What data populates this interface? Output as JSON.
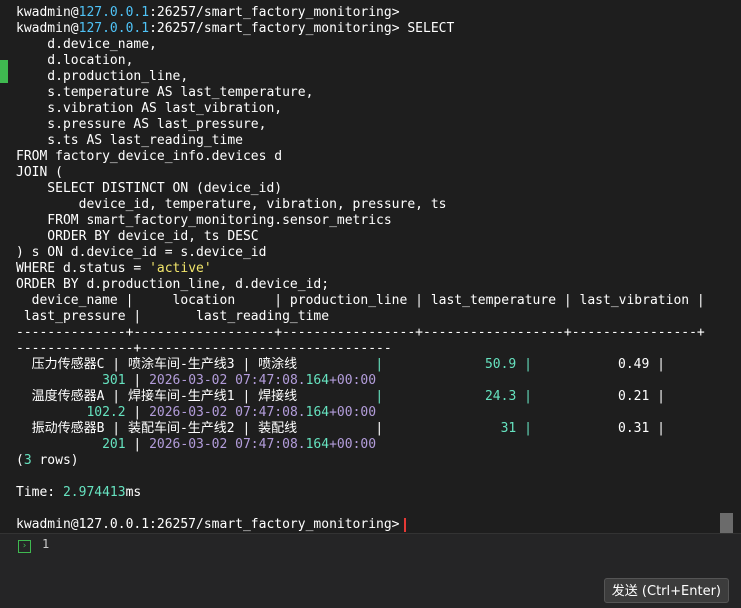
{
  "terminal": {
    "lines": [
      [
        {
          "t": "kwadmin@"
        },
        {
          "t": "127.0.0.1",
          "c": "ip"
        },
        {
          "t": ":26257/smart_factory_monitoring>"
        }
      ],
      [
        {
          "t": "kwadmin@"
        },
        {
          "t": "127.0.0.1",
          "c": "ip"
        },
        {
          "t": ":26257/smart_factory_monitoring> SELECT"
        }
      ],
      [
        {
          "t": "    d.device_name,"
        }
      ],
      [
        {
          "t": "    d.location,"
        }
      ],
      [
        {
          "t": "    d.production_line,"
        }
      ],
      [
        {
          "t": "    s.temperature AS last_temperature,"
        }
      ],
      [
        {
          "t": "    s.vibration AS last_vibration,"
        }
      ],
      [
        {
          "t": "    s.pressure AS last_pressure,"
        }
      ],
      [
        {
          "t": "    s.ts AS last_reading_time"
        }
      ],
      [
        {
          "t": "FROM factory_device_info.devices d"
        }
      ],
      [
        {
          "t": "JOIN ("
        }
      ],
      [
        {
          "t": "    SELECT DISTINCT ON (device_id)"
        }
      ],
      [
        {
          "t": "        device_id, temperature, vibration, pressure, ts"
        }
      ],
      [
        {
          "t": "    FROM smart_factory_monitoring.sensor_metrics"
        }
      ],
      [
        {
          "t": "    ORDER BY device_id, ts DESC"
        }
      ],
      [
        {
          "t": ") s ON d.device_id = s.device_id"
        }
      ],
      [
        {
          "t": "WHERE d.status = "
        },
        {
          "t": "'active'",
          "c": "str"
        }
      ],
      [
        {
          "t": "ORDER BY d.production_line, d.device_id;"
        }
      ],
      [
        {
          "t": "  device_name |     location     | production_line | last_temperature | last_vibration |"
        }
      ],
      [
        {
          "t": " last_pressure |       last_reading_time"
        }
      ],
      [
        {
          "t": "--------------+------------------+-----------------+------------------+----------------+"
        }
      ],
      [
        {
          "t": "---------------+--------------------------------"
        }
      ],
      [
        {
          "t": "  压力传感器C | 喷涂车间-生产线3 | 喷涂线          "
        },
        {
          "t": "|",
          "c": "sep"
        },
        {
          "t": "             50",
          "c": "num"
        },
        {
          "t": ".9",
          "c": "num"
        },
        {
          "t": " |",
          "c": "sep"
        },
        {
          "t": "           0.49 |"
        }
      ],
      [
        {
          "t": "           "
        },
        {
          "t": "301",
          "c": "num"
        },
        {
          "t": " | "
        },
        {
          "t": "2026-03-02 07:47:08.",
          "c": "date"
        },
        {
          "t": "164",
          "c": "num"
        },
        {
          "t": "+00:00",
          "c": "date"
        }
      ],
      [
        {
          "t": "  温度传感器A | 焊接车间-生产线1 | 焊接线          "
        },
        {
          "t": "|",
          "c": "sep"
        },
        {
          "t": "             24.",
          "c": "num"
        },
        {
          "t": "3",
          "c": "num"
        },
        {
          "t": " |",
          "c": "sep"
        },
        {
          "t": "           0.21 |"
        }
      ],
      [
        {
          "t": "         "
        },
        {
          "t": "102.2",
          "c": "num"
        },
        {
          "t": " | "
        },
        {
          "t": "2026-03-02 07:47:08.",
          "c": "date"
        },
        {
          "t": "164",
          "c": "num"
        },
        {
          "t": "+00:00",
          "c": "date"
        }
      ],
      [
        {
          "t": "  振动传感器B | 装配车间-生产线2 | 装配线          |"
        },
        {
          "t": "               31",
          "c": "num"
        },
        {
          "t": " |",
          "c": "sep"
        },
        {
          "t": "           0.31 |"
        }
      ],
      [
        {
          "t": "           "
        },
        {
          "t": "201",
          "c": "num"
        },
        {
          "t": " | "
        },
        {
          "t": "2026-03-02 07:47:08.",
          "c": "date"
        },
        {
          "t": "164",
          "c": "num"
        },
        {
          "t": "+00:00",
          "c": "date"
        }
      ],
      [
        {
          "t": "("
        },
        {
          "t": "3",
          "c": "num"
        },
        {
          "t": " rows)"
        }
      ],
      [
        {
          "t": ""
        }
      ],
      [
        {
          "t": "Time: "
        },
        {
          "t": "2.974413",
          "c": "num"
        },
        {
          "t": "ms"
        }
      ],
      [
        {
          "t": ""
        }
      ],
      [
        {
          "t": "kwadmin@127.0.0.1:26257/smart_factory_monitoring>"
        }
      ]
    ]
  },
  "input": {
    "line_number": "1",
    "icon": "terminal-prompt-icon"
  },
  "send_button": {
    "label": "发送 (Ctrl+Enter)"
  },
  "colors": {
    "background": "#1e1e1e",
    "ip": "#4fc3f7",
    "number": "#66e3c0",
    "string": "#f2e66b",
    "date": "#b39ddb",
    "cursor": "#e53935",
    "marker": "#3fb950"
  }
}
